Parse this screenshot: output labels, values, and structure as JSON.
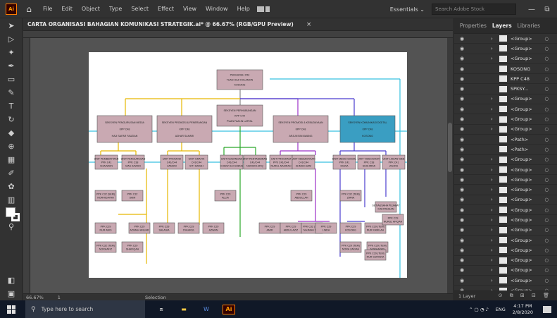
{
  "app": {
    "logo": "Ai",
    "menu": [
      "File",
      "Edit",
      "Object",
      "Type",
      "Select",
      "Effect",
      "View",
      "Window",
      "Help"
    ],
    "workspace": "Essentials",
    "search_placeholder": "Search Adobe Stock",
    "window_controls": [
      "—",
      "⧉"
    ]
  },
  "document": {
    "tab_title": "CARTA ORGANISASI BAHAGIAN KOMUNIKASI STRATEGIK.ai* @ 66.67% (RGB/GPU Preview)",
    "tab_close": "×"
  },
  "status": {
    "zoom": "66.67%",
    "page": "1",
    "selection": "Selection"
  },
  "panel": {
    "tabs": [
      "Properties",
      "Layers",
      "Libraries"
    ],
    "active_tab": "Layers",
    "layers_count": "1 Layer",
    "layers": [
      {
        "name": "<Group>",
        "expandable": true,
        "selected": false
      },
      {
        "name": "<Group>",
        "expandable": true,
        "selected": false
      },
      {
        "name": "<Group>",
        "expandable": true,
        "selected": false
      },
      {
        "name": "KOSONG",
        "expandable": false,
        "selected": false
      },
      {
        "name": "KPP C48",
        "expandable": false,
        "selected": false
      },
      {
        "name": "SPKSY...",
        "expandable": false,
        "selected": false
      },
      {
        "name": "<Group>",
        "expandable": true,
        "selected": false
      },
      {
        "name": "<Group>",
        "expandable": true,
        "selected": false
      },
      {
        "name": "<Group>",
        "expandable": true,
        "selected": false
      },
      {
        "name": "<Group>",
        "expandable": true,
        "selected": false
      },
      {
        "name": "<Path>",
        "expandable": false,
        "selected": false
      },
      {
        "name": "<Path>",
        "expandable": false,
        "selected": false
      },
      {
        "name": "<Group>",
        "expandable": true,
        "selected": false
      },
      {
        "name": "<Group>",
        "expandable": true,
        "selected": false
      },
      {
        "name": "<Group>",
        "expandable": true,
        "selected": false
      },
      {
        "name": "<Group>",
        "expandable": true,
        "selected": false
      },
      {
        "name": "<Group>",
        "expandable": true,
        "selected": false
      },
      {
        "name": "<Group>",
        "expandable": true,
        "selected": false
      },
      {
        "name": "<Group>",
        "expandable": true,
        "selected": false
      },
      {
        "name": "<Group>",
        "expandable": true,
        "selected": false
      },
      {
        "name": "<Group>",
        "expandable": true,
        "selected": false
      },
      {
        "name": "<Group>",
        "expandable": true,
        "selected": false
      },
      {
        "name": "<Group>",
        "expandable": true,
        "selected": false
      },
      {
        "name": "<Group>",
        "expandable": true,
        "selected": false
      },
      {
        "name": "<Group>",
        "expandable": true,
        "selected": false
      },
      {
        "name": "<Group>",
        "expandable": true,
        "selected": false
      },
      {
        "name": "<Linke...",
        "expandable": false,
        "selected": true
      }
    ]
  },
  "org_chart": {
    "top": {
      "line1": "PENGARAH C54",
      "line2": "TUAN HAJI KOLAMON",
      "line3": "KOSONG"
    },
    "mid": {
      "line1": "SEKSYEN PERHUBUNGAN",
      "line2": "KPP C44",
      "line3": "PUAN FAZLIN LATFAL"
    },
    "branches": [
      {
        "title": "SEKSYEN PENGURUSAN MEDIA",
        "grade": "KPP C48",
        "name": "HAJI SAFAR FAUZIAN",
        "color": "#e6b800"
      },
      {
        "title": "SEKSYEN PROMOSI & PENERANGAN",
        "grade": "KPP C48",
        "name": "AZHAR SAHARI",
        "color": "#e6b800"
      },
      {
        "title": "SEKSYEN PROMOSI & KEBUDAYAAN",
        "grade": "KPP C48",
        "name": "ARJUN BIN AWANG",
        "color": "#9b30c8"
      },
      {
        "title": "SEKSYEN KOMUNIKASI DIGITAL",
        "grade": "KPP C48",
        "name": "KOSONG",
        "color": "#4a3ccf"
      }
    ],
    "units": [
      {
        "title": "UNIT PEMBERITAAN",
        "grade": "PPK C41",
        "name": "SHAZWAN",
        "color": "#e6b800"
      },
      {
        "title": "UNIT PENGURUSAN",
        "grade": "PPK C38",
        "name": "MAS AZWAN",
        "color": "#e6b800"
      },
      {
        "title": "UNIT PROMOSI",
        "grade": "C41/C44",
        "name": "ZAMANI",
        "color": "#e6b800"
      },
      {
        "title": "UNIT GRAFIK",
        "grade": "C41/C44",
        "name": "SITI SARAH",
        "color": "#e6b800"
      },
      {
        "title": "UNIT KEWANGAN",
        "grade": "C41/C44",
        "name": "CHIEW HAI SHENG",
        "color": "#2aa829"
      },
      {
        "title": "UNIT PENTADBIRAN",
        "grade": "C41/C44",
        "name": "NURAINI AFIQ",
        "color": "#2aa829"
      },
      {
        "title": "UNIT PROGRAM",
        "grade": "PPK C41/C44",
        "name": "NURUL NAZIRAH",
        "color": "#9b30c8"
      },
      {
        "title": "UNIT KEBUDAYAAN",
        "grade": "C41/C44",
        "name": "AHMAD AZIM",
        "color": "#9b30c8"
      },
      {
        "title": "UNIT MEDIA SOSIAL",
        "grade": "PPK C41",
        "name": "DIANA",
        "color": "#4a3ccf"
      },
      {
        "title": "UNIT VIDEOGRAFI",
        "grade": "PPK C38",
        "name": "SHAHIRAN",
        "color": "#4a3ccf"
      },
      {
        "title": "UNIT LAMAN WEB",
        "grade": "PPK C41",
        "name": "ZAHRA",
        "color": "#4a3ccf"
      }
    ],
    "staff": [
      {
        "title": "PPK C32 (SEM)",
        "name": "NORHIDAYAH"
      },
      {
        "title": "PPK C32",
        "name": "SAMI"
      },
      {
        "title": "PPK C29",
        "name": "NUR ANIS"
      },
      {
        "title": "PPK C29",
        "name": "AZIMAH ANUAR"
      },
      {
        "title": "PPK C29",
        "name": "SALASIA"
      },
      {
        "title": "PPK C29",
        "name": "SYAHRUL"
      },
      {
        "title": "PPK C29",
        "name": "AZWAN"
      },
      {
        "title": "PPK C29",
        "name": "ALLIA"
      },
      {
        "title": "PPK C32 (TEM)",
        "name": "NORHAFIZ"
      },
      {
        "title": "PPK C29",
        "name": "SHAFIQAH"
      },
      {
        "title": "PPK C29",
        "name": "AMIR"
      },
      {
        "title": "PPK C29",
        "name": "ABDUL AZIZ"
      },
      {
        "title": "PPK C32 (TEM)",
        "name": "NAJMAH SAID"
      },
      {
        "title": "PPK C29",
        "name": "ABDULLAH"
      },
      {
        "title": "PPK C29",
        "name": "LINDA"
      },
      {
        "title": "PPK C32 (TEM)",
        "name": "ZIANA"
      },
      {
        "title": "PPK C29",
        "name": "KOSONG"
      },
      {
        "title": "PPK C29 (TEM)",
        "name": "NUR KAMILAH"
      },
      {
        "title": "PPK C29 (TEM)",
        "name": "NORA ZAKIAH"
      },
      {
        "title": "PPK C29 (TEM)",
        "name": "NORHAYATI"
      },
      {
        "title": "PPK C29",
        "name": "NURUL AFIQAH"
      },
      {
        "title": "PPK C29 (TEM)",
        "name": "NUR SURIANA"
      },
      {
        "title": "SETIAUSAHA PEJABAT",
        "name": "KAKITANGAN"
      }
    ]
  },
  "taskbar": {
    "search_placeholder": "Type here to search",
    "lang": "ENG",
    "time": "4:17 PM",
    "date": "2/8/2020"
  }
}
